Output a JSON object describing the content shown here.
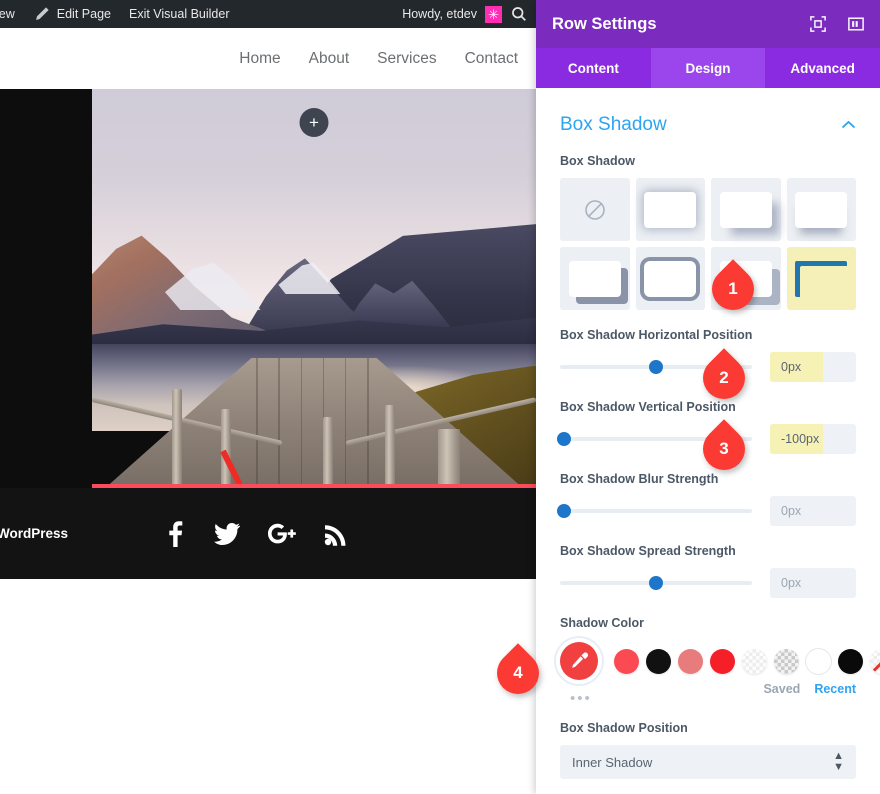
{
  "adminbar": {
    "items": [
      {
        "label": "lew",
        "icon": "none"
      },
      {
        "label": "Edit Page",
        "icon": "pencil-icon"
      },
      {
        "label": "Exit Visual Builder",
        "icon": "none"
      }
    ],
    "howdy": "Howdy, etdev",
    "avatar_glyph": "✳",
    "avatar_color": "#ff2eb3",
    "search_icon": "search-icon"
  },
  "site_nav": {
    "links": [
      "Home",
      "About",
      "Services",
      "Contact"
    ]
  },
  "canvas": {
    "add_row_label": "+",
    "red_band_color": "#fc4b5a",
    "arrow_color": "#ef2b25"
  },
  "footer": {
    "credit": "WordPress",
    "social": [
      "facebook-icon",
      "twitter-icon",
      "google-plus-icon",
      "rss-icon"
    ]
  },
  "panel": {
    "title": "Row Settings",
    "header_icons": [
      "focus-target-icon",
      "panel-layout-icon"
    ],
    "tabs": [
      {
        "label": "Content",
        "active": false
      },
      {
        "label": "Design",
        "active": true
      },
      {
        "label": "Advanced",
        "active": false
      }
    ],
    "section": {
      "title": "Box Shadow",
      "collapse_icon": "chevron-up-icon"
    },
    "box_shadow": {
      "label": "Box Shadow",
      "presets": [
        {
          "name": "none",
          "selected": false
        },
        {
          "name": "soft-glow",
          "selected": false
        },
        {
          "name": "bottom-right-blur",
          "selected": false
        },
        {
          "name": "bottom-blur",
          "selected": false
        },
        {
          "name": "hard-bottom-right",
          "selected": false
        },
        {
          "name": "outline-ring",
          "selected": false
        },
        {
          "name": "offset-flat",
          "selected": false
        },
        {
          "name": "inner-shadow",
          "selected": true
        }
      ]
    },
    "sliders": [
      {
        "label": "Box Shadow Horizontal Position",
        "value": "0px",
        "knob_percent": 50,
        "highlighted": true,
        "name": "horizontal-position"
      },
      {
        "label": "Box Shadow Vertical Position",
        "value": "-100px",
        "knob_percent": 2,
        "highlighted": true,
        "name": "vertical-position"
      },
      {
        "label": "Box Shadow Blur Strength",
        "value": "0px",
        "knob_percent": 2,
        "highlighted": false,
        "name": "blur-strength"
      },
      {
        "label": "Box Shadow Spread Strength",
        "value": "0px",
        "knob_percent": 50,
        "highlighted": false,
        "name": "spread-strength"
      }
    ],
    "shadow_color": {
      "label": "Shadow Color",
      "eyedropper_color": "#f0403f",
      "eyedropper_icon": "eyedropper-icon",
      "swatches": [
        {
          "color": "#fb4a52",
          "name": "coral-red"
        },
        {
          "color": "#111111",
          "name": "black"
        },
        {
          "color": "#e87b7b",
          "name": "dusty-pink"
        },
        {
          "color": "#f51f28",
          "name": "bright-red"
        },
        {
          "color": "#f6f4f4",
          "name": "near-white-transparent"
        },
        {
          "color": "#c9c9c9",
          "name": "gray-transparent"
        },
        {
          "color": "#ffffff",
          "name": "white"
        },
        {
          "color": "#0a0a0a",
          "name": "solid-black"
        },
        {
          "color": "transparent",
          "name": "transparent"
        }
      ],
      "more_dots": "•••",
      "saved_label": "Saved",
      "recent_label": "Recent"
    },
    "position_field": {
      "label": "Box Shadow Position",
      "value": "Inner Shadow"
    }
  },
  "markers": [
    {
      "number": "1",
      "target": "inner-shadow-preset"
    },
    {
      "number": "2",
      "target": "horizontal-position-input"
    },
    {
      "number": "3",
      "target": "vertical-position-input"
    },
    {
      "number": "4",
      "target": "eyedropper-button"
    }
  ]
}
